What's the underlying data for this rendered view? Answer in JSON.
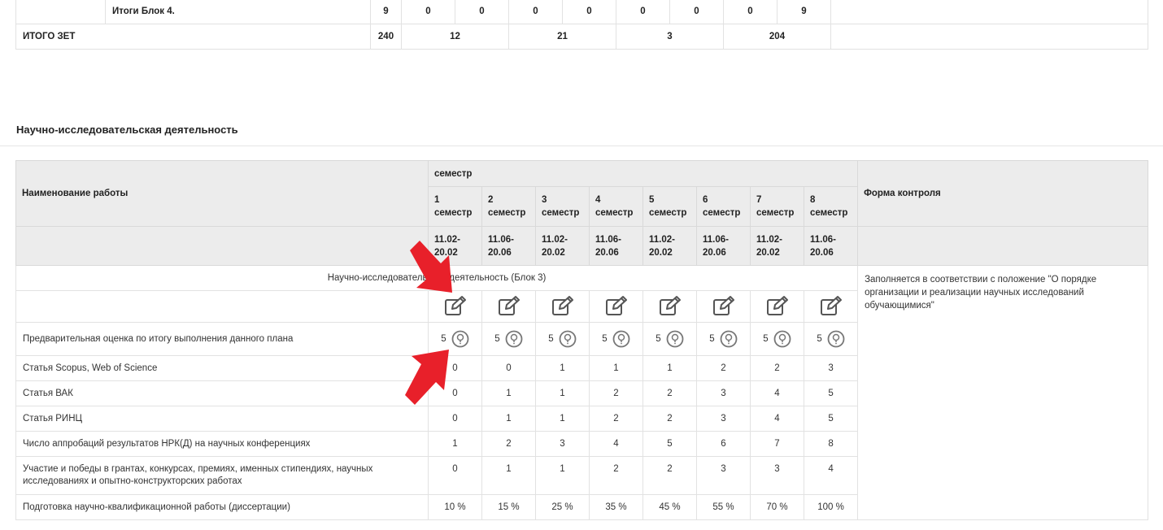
{
  "top_table": {
    "block_row": {
      "label": "Итоги Блок 4.",
      "values": [
        "9",
        "0",
        "0",
        "0",
        "0",
        "0",
        "0",
        "0",
        "9"
      ]
    },
    "total_row": {
      "label": "ИТОГО ЗЕТ",
      "values": [
        "240",
        "12",
        "21",
        "3",
        "204"
      ]
    }
  },
  "section_title": "Научно-исследовательская деятельность",
  "table": {
    "col_name_header": "Наименование работы",
    "semester_group_header": "семестр",
    "control_header": "Форма контроля",
    "semesters": [
      {
        "num": "1",
        "label": "семестр",
        "dates": "11.02-\n20.02"
      },
      {
        "num": "2",
        "label": "семестр",
        "dates": "11.06-\n20.06"
      },
      {
        "num": "3",
        "label": "семестр",
        "dates": "11.02-\n20.02"
      },
      {
        "num": "4",
        "label": "семестр",
        "dates": "11.06-\n20.06"
      },
      {
        "num": "5",
        "label": "семестр",
        "dates": "11.02-\n20.02"
      },
      {
        "num": "6",
        "label": "семестр",
        "dates": "11.06-\n20.06"
      },
      {
        "num": "7",
        "label": "семестр",
        "dates": "11.02-\n20.02"
      },
      {
        "num": "8",
        "label": "семестр",
        "dates": "11.06-\n20.06"
      }
    ],
    "block_label": "Научно-исследовательская деятельность (Блок 3)",
    "control_note": "Заполняется в соответствии с положение \"О порядке организации и реализации научных исследований обучающимися\"",
    "edit_icon": "edit-icon",
    "help_icon": "question-circle-icon",
    "rows": [
      {
        "name": "Предварительная оценка по итогу выполнения данного плана",
        "values": [
          "5",
          "5",
          "5",
          "5",
          "5",
          "5",
          "5",
          "5"
        ],
        "has_help": true
      },
      {
        "name": "Статья Scopus, Web of Science",
        "values": [
          "0",
          "0",
          "1",
          "1",
          "1",
          "2",
          "2",
          "3"
        ]
      },
      {
        "name": "Статья ВАК",
        "values": [
          "0",
          "1",
          "1",
          "2",
          "2",
          "3",
          "4",
          "5"
        ]
      },
      {
        "name": "Статья РИНЦ",
        "values": [
          "0",
          "1",
          "1",
          "2",
          "2",
          "3",
          "4",
          "5"
        ]
      },
      {
        "name": "Число аппробаций результатов НРК(Д) на научных конференциях",
        "values": [
          "1",
          "2",
          "3",
          "4",
          "5",
          "6",
          "7",
          "8"
        ]
      },
      {
        "name": "Участие и победы в грантах, конкурсах, премиях, именных стипендиях, научных исследованиях и опытно-конструкторских работах",
        "values": [
          "0",
          "1",
          "1",
          "2",
          "2",
          "3",
          "3",
          "4"
        ]
      },
      {
        "name": "Подготовка научно-квалификационной работы (диссертации)",
        "values": [
          "10 %",
          "15 %",
          "25 %",
          "35 %",
          "45 %",
          "55 %",
          "70 %",
          "100 %"
        ]
      }
    ]
  },
  "colors": {
    "header_bg": "#ececec",
    "arrow": "#e8202a",
    "icon": "#555555"
  }
}
